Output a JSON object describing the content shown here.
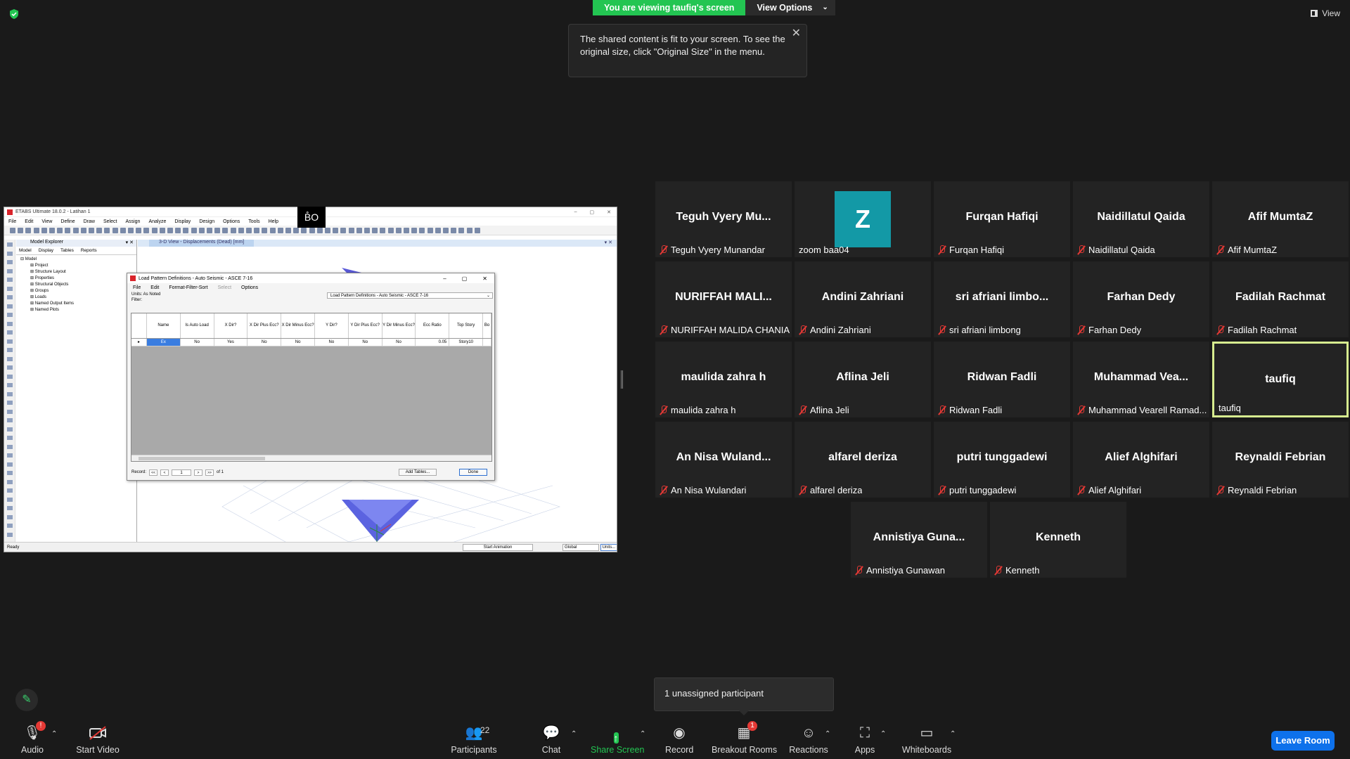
{
  "banner": {
    "viewing": "You are viewing taufiq's screen",
    "view_options": "View Options"
  },
  "top_view": "View",
  "tooltip": {
    "text": "The shared content is fit to your screen. To see the original size, click \"Original Size\" in the menu."
  },
  "etabs": {
    "title": "ETABS Ultimate 18.0.2 - Latihan 1",
    "menu": [
      "File",
      "Edit",
      "View",
      "Define",
      "Draw",
      "Select",
      "Assign",
      "Analyze",
      "Display",
      "Design",
      "Options",
      "Tools",
      "Help"
    ],
    "explorer_title": "Model Explorer",
    "explorer_tabs": [
      "Model",
      "Display",
      "Tables",
      "Reports"
    ],
    "tree_root": "Model",
    "tree": [
      "Project",
      "Structure Layout",
      "Properties",
      "Structural Objects",
      "Groups",
      "Loads",
      "Named Output Items",
      "Named Plots"
    ],
    "view_tab": "3-D View  - Displacements (Dead)  [mm]",
    "status_ready": "Ready",
    "start_animation": "Start Animation",
    "global": "Global",
    "units": "Units...",
    "bo_logo": "B̊O"
  },
  "dialog": {
    "title": "Load Pattern Definitions - Auto Seismic - ASCE 7-16",
    "menu": [
      "File",
      "Edit",
      "Format-Filter-Sort",
      "Select",
      "Options"
    ],
    "units_label": "Units: As Noted",
    "filter_label": "Filter:",
    "table_select": "Load Pattern Definitions - Auto Seismic - ASCE 7-16",
    "columns": [
      "Name",
      "Is Auto Load",
      "X Dir?",
      "X Dir Plus Ecc?",
      "X Dir Minus Ecc?",
      "Y Dir?",
      "Y Dir Plus Ecc?",
      "Y Dir Minus Ecc?",
      "Ecc Ratio",
      "Top Story",
      "Bo"
    ],
    "row": [
      "Ex",
      "No",
      "Yes",
      "No",
      "No",
      "No",
      "No",
      "No",
      "0.05",
      "Story10",
      ""
    ],
    "record_label": "Record:",
    "nav": [
      "<<",
      "<",
      ">",
      ">>"
    ],
    "record_value": "1",
    "of_label": "of 1",
    "add_tables": "Add Tables...",
    "done": "Done"
  },
  "participants": [
    {
      "big": "Teguh Vyery Mu...",
      "small": "Teguh Vyery Munandar",
      "muted": true
    },
    {
      "big": "",
      "small": "zoom baa04",
      "muted": false,
      "avatar": "Z"
    },
    {
      "big": "Furqan Hafiqi",
      "small": "Furqan Hafiqi",
      "muted": true
    },
    {
      "big": "Naidillatul Qaida",
      "small": "Naidillatul Qaida",
      "muted": true
    },
    {
      "big": "Afif MumtaZ",
      "small": "Afif MumtaZ",
      "muted": true
    },
    {
      "big": "NURIFFAH MALI...",
      "small": "NURIFFAH MALIDA CHANIA",
      "muted": true
    },
    {
      "big": "Andini Zahriani",
      "small": "Andini Zahriani",
      "muted": true
    },
    {
      "big": "sri afriani limbo...",
      "small": "sri afriani limbong",
      "muted": true
    },
    {
      "big": "Farhan Dedy",
      "small": "Farhan Dedy",
      "muted": true
    },
    {
      "big": "Fadilah Rachmat",
      "small": "Fadilah Rachmat",
      "muted": true
    },
    {
      "big": "maulida zahra h",
      "small": "maulida zahra h",
      "muted": true
    },
    {
      "big": "Aflina Jeli",
      "small": "Aflina Jeli",
      "muted": true
    },
    {
      "big": "Ridwan Fadli",
      "small": "Ridwan Fadli",
      "muted": true
    },
    {
      "big": "Muhammad Vea...",
      "small": "Muhammad Vearell Ramad...",
      "muted": true
    },
    {
      "big": "taufiq",
      "small": "taufiq",
      "muted": false,
      "active": true
    },
    {
      "big": "An Nisa Wuland...",
      "small": "An Nisa Wulandari",
      "muted": true
    },
    {
      "big": "alfarel deriza",
      "small": "alfarel deriza",
      "muted": true
    },
    {
      "big": "putri tunggadewi",
      "small": "putri tunggadewi",
      "muted": true
    },
    {
      "big": "Alief Alghifari",
      "small": "Alief Alghifari",
      "muted": true
    },
    {
      "big": "Reynaldi Febrian",
      "small": "Reynaldi Febrian",
      "muted": true
    },
    {
      "big": "Annistiya Guna...",
      "small": "Annistiya Gunawan",
      "muted": true
    },
    {
      "big": "Kenneth",
      "small": "Kenneth",
      "muted": true
    }
  ],
  "unassigned": "1 unassigned participant",
  "toolbar": {
    "audio": "Audio",
    "start_video": "Start Video",
    "participants": "Participants",
    "participants_count": "22",
    "chat": "Chat",
    "share_screen": "Share Screen",
    "record": "Record",
    "breakout_rooms": "Breakout Rooms",
    "breakout_badge": "1",
    "audio_badge": "!",
    "reactions": "Reactions",
    "apps": "Apps",
    "whiteboards": "Whiteboards",
    "leave_room": "Leave Room"
  },
  "colors": {
    "accent_green": "#23c552",
    "leave_blue": "#0e71eb",
    "mute_red": "#e53935",
    "active_border": "#d7ec8f",
    "avatar_teal": "#1399a6"
  },
  "icons": [
    "shield-icon",
    "close-icon",
    "mic-icon",
    "video-off-icon",
    "participants-icon",
    "chat-icon",
    "share-screen-icon",
    "record-icon",
    "breakout-rooms-icon",
    "reactions-icon",
    "apps-icon",
    "whiteboards-icon",
    "pencil-icon",
    "muted-mic-icon"
  ]
}
